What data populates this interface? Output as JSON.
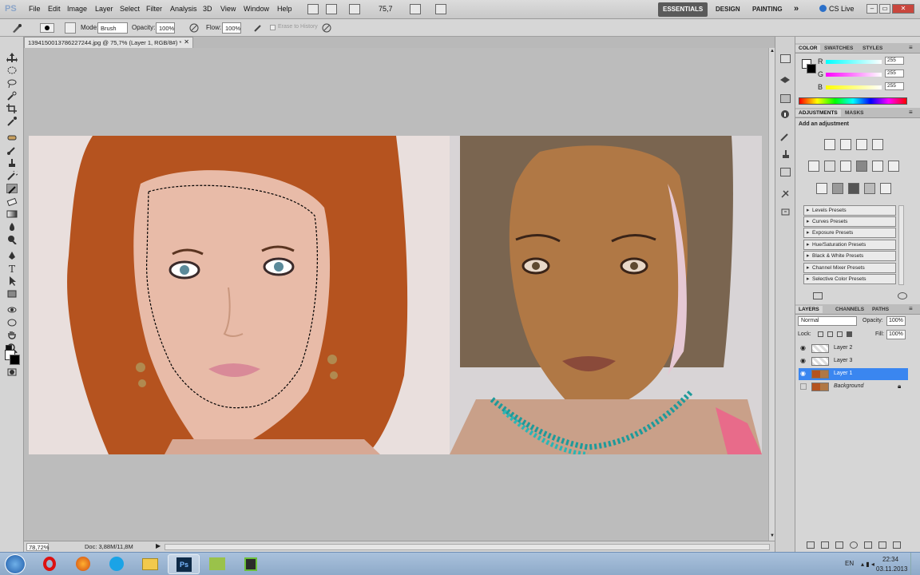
{
  "app": {
    "logo": "PS"
  },
  "menu": [
    "File",
    "Edit",
    "Image",
    "Layer",
    "Select",
    "Filter",
    "Analysis",
    "3D",
    "View",
    "Window",
    "Help"
  ],
  "menubar": {
    "zoom": "75,7",
    "workspaces": [
      "ESSENTIALS",
      "DESIGN",
      "PAINTING"
    ],
    "more": "»",
    "cslive": "CS Live"
  },
  "options": {
    "mode_label": "Mode:",
    "mode_value": "Brush",
    "opacity_label": "Opacity:",
    "opacity_value": "100%",
    "flow_label": "Flow:",
    "flow_value": "100%",
    "erase_history": "Erase to History"
  },
  "document": {
    "tab_title": "1394150013786227244.jpg @ 75,7% (Layer 1, RGB/8#) *",
    "zoom_status": "78,72%",
    "doc_info": "Doc: 3,88M/11,8M"
  },
  "color_panel": {
    "tabs": [
      "COLOR",
      "SWATCHES",
      "STYLES"
    ],
    "channels": [
      {
        "name": "R",
        "value": "255"
      },
      {
        "name": "G",
        "value": "255"
      },
      {
        "name": "B",
        "value": "255"
      }
    ]
  },
  "adjustments": {
    "tabs": [
      "ADJUSTMENTS",
      "MASKS"
    ],
    "heading": "Add an adjustment",
    "presets": [
      "Levels Presets",
      "Curves Presets",
      "Exposure Presets",
      "Hue/Saturation Presets",
      "Black & White Presets",
      "Channel Mixer Presets",
      "Selective Color Presets"
    ]
  },
  "layers_panel": {
    "tabs": [
      "LAYERS",
      "CHANNELS",
      "PATHS"
    ],
    "blend_mode": "Normal",
    "opacity_label": "Opacity:",
    "opacity_value": "100%",
    "lock_label": "Lock:",
    "fill_label": "Fill:",
    "fill_value": "100%",
    "layers": [
      {
        "name": "Layer 2",
        "visible": true,
        "selected": false
      },
      {
        "name": "Layer 3",
        "visible": true,
        "selected": false
      },
      {
        "name": "Layer 1",
        "visible": true,
        "selected": true
      },
      {
        "name": "Background",
        "visible": false,
        "selected": false,
        "locked": true
      }
    ]
  },
  "taskbar": {
    "lang": "EN",
    "time": "22:34",
    "date": "03.11.2013"
  },
  "colors": {
    "selection": "#3a86f0",
    "hair_left": "#b5531f",
    "skin_left": "#e8bba8",
    "skin_right": "#b07845"
  }
}
